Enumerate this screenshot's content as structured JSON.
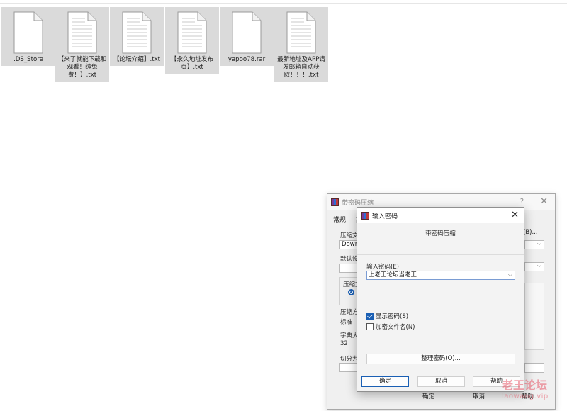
{
  "files": [
    {
      "name": ".DS_Store",
      "lined": false
    },
    {
      "name": "【来了就能下载和观看！纯免费！】.txt",
      "lined": true
    },
    {
      "name": "【论坛介绍】.txt",
      "lined": true
    },
    {
      "name": "【永久地址发布页】.txt",
      "lined": true
    },
    {
      "name": "yapoo78.rar",
      "lined": false
    },
    {
      "name": "最新地址及APP请发邮箱自动获取！！！.txt",
      "lined": true
    }
  ],
  "back_dialog": {
    "title": "带密码压缩",
    "help": "?",
    "close": "✕",
    "tab_general": "常规",
    "tab_partial": "高",
    "archive_label": "压缩文",
    "archive_value": "Downl",
    "browse_label": "(B)...",
    "profile_label": "默认设",
    "format_label": "压缩文",
    "method_label": "压缩方",
    "method_value": "标准",
    "dict_label": "字典大",
    "dict_value": "32",
    "split_label": "切分为",
    "ok": "确定",
    "cancel": "取消",
    "help_btn": "帮助"
  },
  "front_dialog": {
    "title": "输入密码",
    "close": "✕",
    "header": "带密码压缩",
    "password_label": "输入密码(E)",
    "password_value": "上老王论坛当老王",
    "show_password": {
      "label": "显示密码(S)",
      "checked": true
    },
    "encrypt_names": {
      "label": "加密文件名(N)",
      "checked": false
    },
    "organize_button": "整理密码(O)...",
    "ok": "确定",
    "cancel": "取消",
    "help": "帮助"
  },
  "watermark": {
    "line1": "老王论坛",
    "line2": "laowang.vip"
  },
  "colors": {
    "accent": "#1a5fb4",
    "file_bg": "#dadada",
    "watermark": "#e85a6a"
  }
}
